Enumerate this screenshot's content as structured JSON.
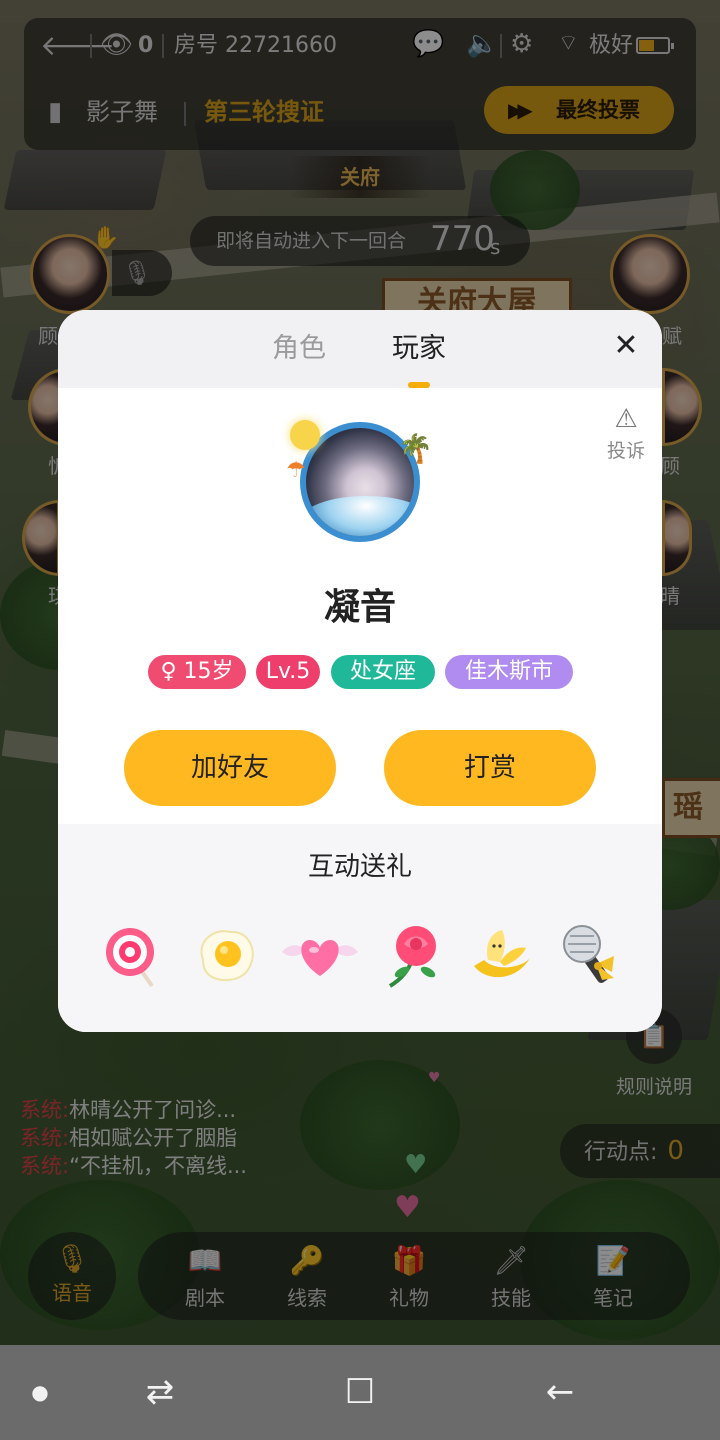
{
  "topbar": {
    "viewer_count": "0",
    "room_label": "房号 22721660",
    "signal_label": "极好",
    "battery_level": 0.55,
    "script_name": "影子舞",
    "round_label": "第三轮搜证",
    "final_vote_label": "最终投票"
  },
  "scene": {
    "location_label": "关府",
    "countdown_text": "即将自动进入下一回合",
    "countdown_value": "770",
    "countdown_unit": "s",
    "sign_1": "关府大屋",
    "sign_2": "瑶阶"
  },
  "side_names": {
    "left_1": "顾",
    "left_2": "忻",
    "left_3": "琪",
    "right_1": "赋",
    "right_2": "顾",
    "right_3": "晴"
  },
  "modal": {
    "tabs": [
      "角色",
      "玩家"
    ],
    "active_tab": "玩家",
    "report_label": "投诉",
    "player_name": "凝音",
    "tags": [
      {
        "label": "♀ 15岁",
        "color": "#f04b70"
      },
      {
        "label": "Lv.5",
        "color": "#ee3e6b"
      },
      {
        "label": "处女座",
        "color": "#1fb99a"
      },
      {
        "label": "佳木斯市",
        "color": "#b08cf0"
      }
    ],
    "add_friend_label": "加好友",
    "tip_label": "打赏",
    "gift_section_title": "互动送礼",
    "gifts": [
      "lollipop-icon",
      "fried-egg-icon",
      "winged-heart-icon",
      "rose-icon",
      "banana-icon",
      "microphone-icon"
    ]
  },
  "chat": {
    "lines": [
      {
        "sys": "系统:",
        "text": "林晴公开了问诊..."
      },
      {
        "sys": "系统:",
        "text": "相如赋公开了胭脂"
      },
      {
        "sys": "系统:",
        "text": "“不挂机，不离线..."
      }
    ]
  },
  "rules_label": "规则说明",
  "action_points": {
    "label": "行动点:",
    "value": "0"
  },
  "bottom": {
    "voice_label": "语音",
    "tools": [
      "剧本",
      "线索",
      "礼物",
      "技能",
      "笔记"
    ]
  },
  "colors": {
    "accent": "#ffb81f",
    "gold_text": "#e0a52a",
    "system_red": "#e2434a"
  }
}
